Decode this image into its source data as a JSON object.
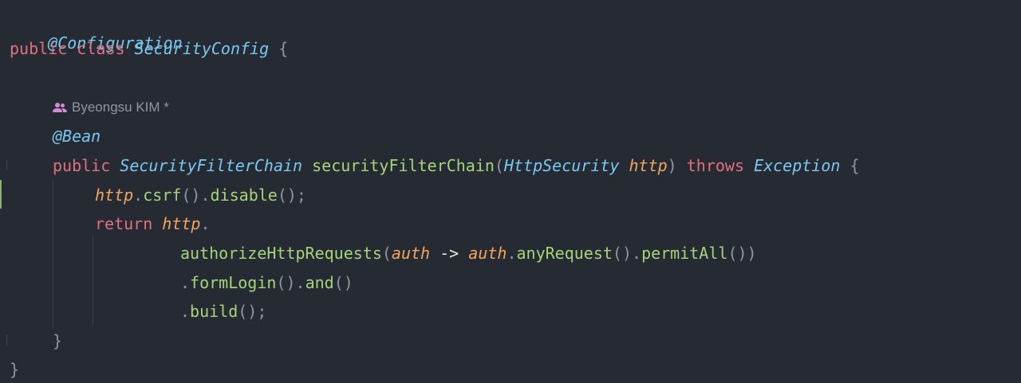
{
  "author": {
    "name": "Byeongsu KIM *",
    "icon": "people-icon"
  },
  "code": {
    "line1": {
      "annotation": "@Configuration"
    },
    "line2": {
      "kw_public": "public",
      "kw_class": "class",
      "class_name": "SecurityConfig",
      "brace": "{"
    },
    "line4": {
      "annotation": "@Bean"
    },
    "line5": {
      "kw_public": "public",
      "return_type": "SecurityFilterChain",
      "method_name": "securityFilterChain",
      "paren_open": "(",
      "param_type": "HttpSecurity",
      "param_name": "http",
      "paren_close": ")",
      "kw_throws": "throws",
      "exception_type": "Exception",
      "brace": "{"
    },
    "line6": {
      "var": "http",
      "dot1": ".",
      "call1": "csrf",
      "parens1": "()",
      "dot2": ".",
      "call2": "disable",
      "end": "();"
    },
    "line7": {
      "kw_return": "return",
      "var": "http",
      "dot": "."
    },
    "line8": {
      "call": "authorizeHttpRequests",
      "paren_open": "(",
      "lambda_param": "auth",
      "arrow": "->",
      "lambda_var": "auth",
      "dot1": ".",
      "call1": "anyRequest",
      "parens1": "()",
      "dot2": ".",
      "call2": "permitAll",
      "end": "())"
    },
    "line9": {
      "dot1": ".",
      "call1": "formLogin",
      "parens1": "()",
      "dot2": ".",
      "call2": "and",
      "end": "()"
    },
    "line10": {
      "dot": ".",
      "call": "build",
      "end": "();"
    },
    "line11": {
      "brace": "}"
    },
    "line12": {
      "brace": "}"
    }
  },
  "colors": {
    "background": "#262b33",
    "keyword": "#e0707e",
    "type": "#79c7f0",
    "function": "#a6d47a",
    "parameter": "#f2a55e",
    "punctuation": "#8f96a3"
  }
}
